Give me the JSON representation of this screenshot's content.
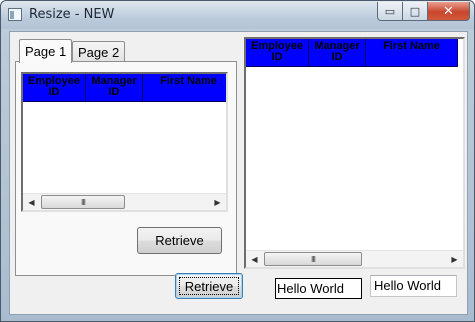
{
  "window": {
    "title": "Resize - NEW",
    "controls": {
      "minimize": "▭",
      "maximize": "□",
      "close": "✕"
    }
  },
  "tabs": [
    {
      "label": "Page 1",
      "selected": true
    },
    {
      "label": "Page 2",
      "selected": false
    }
  ],
  "grid_left": {
    "columns": [
      "Employee ID",
      "Manager ID",
      "First Name"
    ],
    "rows": []
  },
  "grid_right": {
    "columns": [
      "Employee ID",
      "Manager ID",
      "First Name"
    ],
    "rows": []
  },
  "scrollbar": {
    "left_arrow": "◀",
    "right_arrow": "▶",
    "thumb_grip": "III"
  },
  "tab_page": {
    "retrieve_label": "Retrieve"
  },
  "bottom": {
    "retrieve_label": "Retrieve",
    "label_text": "Hello World",
    "field_value": "Hello World"
  },
  "colors": {
    "grid_header": "#0000ff",
    "close_button": "#c9462c"
  }
}
